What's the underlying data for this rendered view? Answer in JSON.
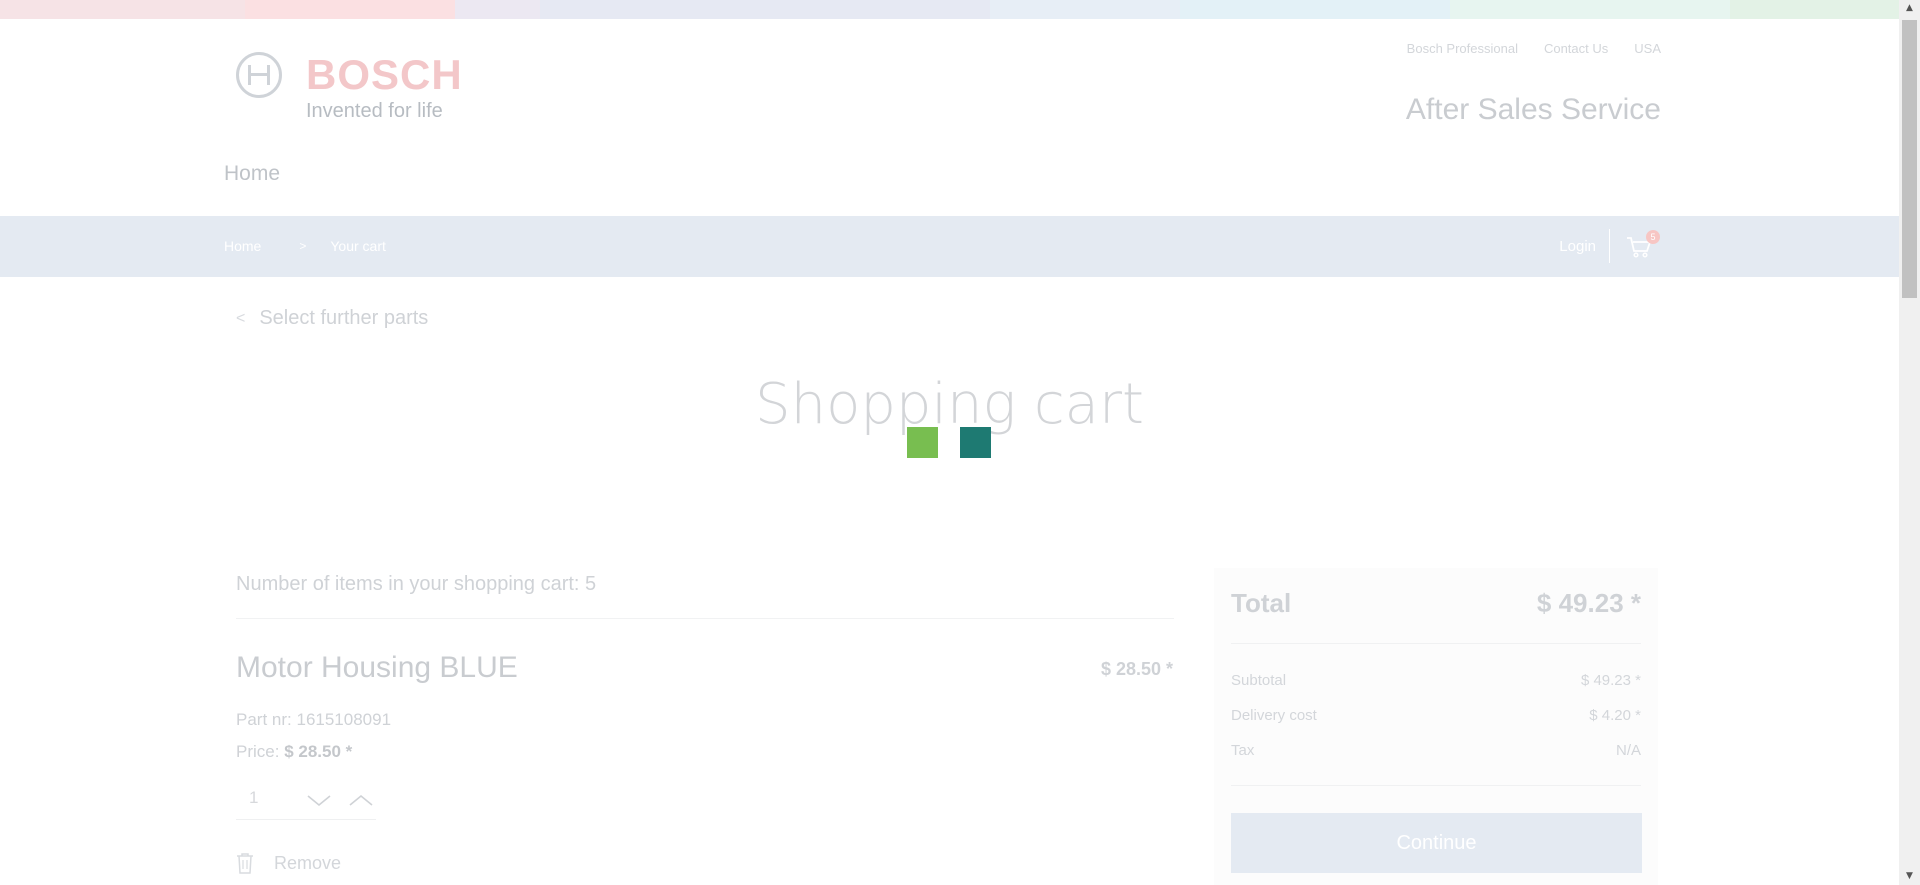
{
  "header": {
    "logo_word": "BOSCH",
    "logo_tagline": "Invented for life",
    "meta_links": [
      "Bosch Professional",
      "Contact Us",
      "USA"
    ],
    "brand_title": "After Sales Service",
    "main_nav_home": "Home"
  },
  "top_strip_colors": [
    "#f6e3e6",
    "#fbe0e2",
    "#ece8f2",
    "#e6e9f3",
    "#e7eef6",
    "#e3f1f7",
    "#e7f5f0",
    "#e3f2e6"
  ],
  "breadcrumb": {
    "home": "Home",
    "separator": ">",
    "current": "Your cart",
    "login": "Login",
    "cart_count": "5"
  },
  "back_link": {
    "label": "Select further parts",
    "chevron": "<"
  },
  "page_title": "Shopping cart",
  "loader_colors": [
    "#78be50",
    "#1e7a72"
  ],
  "cart": {
    "items_count_text": "Number of items in your shopping cart: 5",
    "items": [
      {
        "name": "Motor Housing BLUE",
        "line_price": "$ 28.50 *",
        "part_nr_label": "Part nr:",
        "part_nr": "1615108091",
        "price_label": "Price:",
        "unit_price": "$ 28.50 *",
        "quantity": "1",
        "remove_label": "Remove"
      }
    ]
  },
  "summary": {
    "total_label": "Total",
    "total_value": "$ 49.23 *",
    "subtotal_label": "Subtotal",
    "subtotal_value": "$ 49.23 *",
    "delivery_label": "Delivery cost",
    "delivery_value": "$ 4.20 *",
    "tax_label": "Tax",
    "tax_value": "N/A",
    "continue_label": "Continue"
  }
}
